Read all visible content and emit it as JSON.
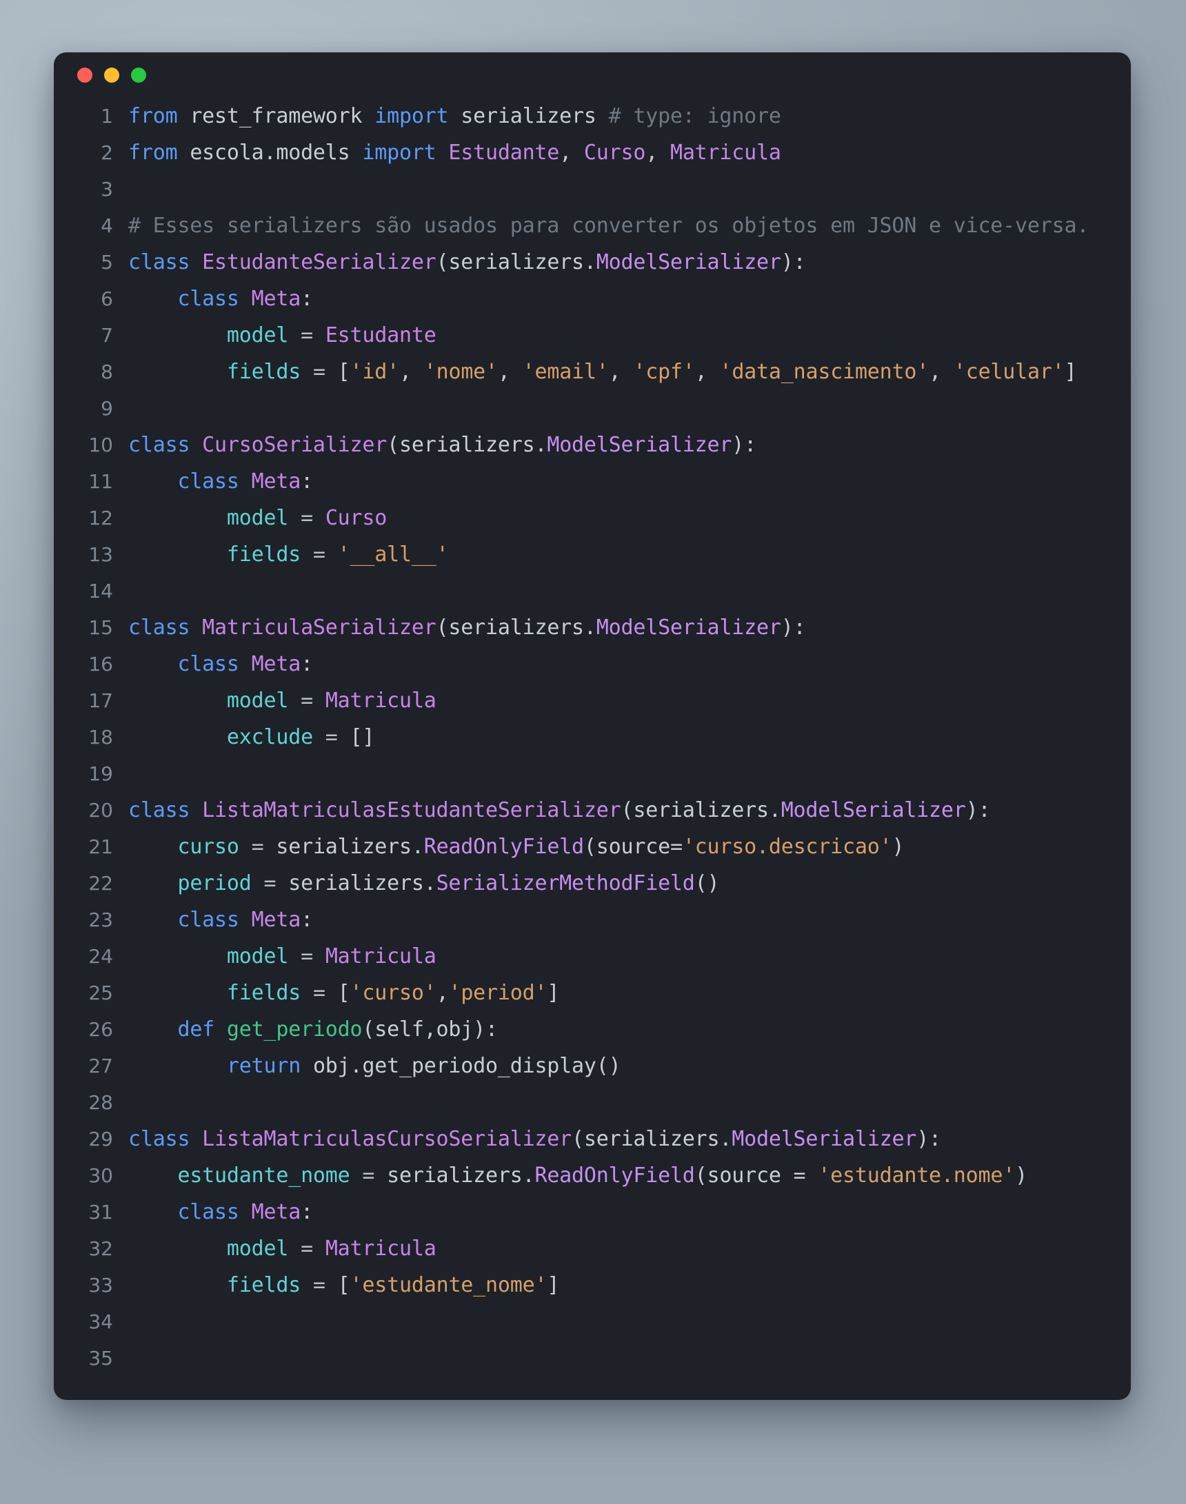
{
  "window": {
    "traffic_lights": [
      {
        "name": "close",
        "color": "#ff5f57"
      },
      {
        "name": "minimize",
        "color": "#febc2e"
      },
      {
        "name": "maximize",
        "color": "#28c840"
      }
    ],
    "background": "#1e2127",
    "page_background": "#a3afba"
  },
  "theme": {
    "keyword": "#5b9bf8",
    "class": "#c586e8",
    "attribute": "#5ed4d4",
    "string": "#d6a06a",
    "function": "#3ec98a",
    "plain": "#c9ced6",
    "comment": "#6f7884",
    "lineno": "#7e8794"
  },
  "code": {
    "language": "python",
    "total_lines": 35,
    "lines": [
      {
        "n": "1",
        "tokens": [
          {
            "t": "from ",
            "c": "kw"
          },
          {
            "t": "rest_framework ",
            "c": "plain"
          },
          {
            "t": "import ",
            "c": "kw"
          },
          {
            "t": "serializers ",
            "c": "plain"
          },
          {
            "t": "# type: ignore",
            "c": "com"
          }
        ]
      },
      {
        "n": "2",
        "tokens": [
          {
            "t": "from ",
            "c": "kw"
          },
          {
            "t": "escola.models ",
            "c": "plain"
          },
          {
            "t": "import ",
            "c": "kw"
          },
          {
            "t": "Estudante",
            "c": "cls"
          },
          {
            "t": ", ",
            "c": "plain"
          },
          {
            "t": "Curso",
            "c": "cls"
          },
          {
            "t": ", ",
            "c": "plain"
          },
          {
            "t": "Matricula",
            "c": "cls"
          }
        ]
      },
      {
        "n": "3",
        "tokens": []
      },
      {
        "n": "4",
        "tokens": [
          {
            "t": "# Esses serializers são usados para converter os objetos em JSON e vice-versa.",
            "c": "com"
          }
        ]
      },
      {
        "n": "5",
        "tokens": [
          {
            "t": "class ",
            "c": "kw"
          },
          {
            "t": "EstudanteSerializer",
            "c": "cls"
          },
          {
            "t": "(",
            "c": "plain"
          },
          {
            "t": "serializers.",
            "c": "plain"
          },
          {
            "t": "ModelSerializer",
            "c": "cls2"
          },
          {
            "t": "):",
            "c": "plain"
          }
        ]
      },
      {
        "n": "6",
        "tokens": [
          {
            "t": "    ",
            "c": "plain"
          },
          {
            "t": "class ",
            "c": "kw"
          },
          {
            "t": "Meta",
            "c": "cls"
          },
          {
            "t": ":",
            "c": "plain"
          }
        ]
      },
      {
        "n": "7",
        "tokens": [
          {
            "t": "        ",
            "c": "plain"
          },
          {
            "t": "model",
            "c": "attr"
          },
          {
            "t": " = ",
            "c": "op"
          },
          {
            "t": "Estudante",
            "c": "cls"
          }
        ]
      },
      {
        "n": "8",
        "tokens": [
          {
            "t": "        ",
            "c": "plain"
          },
          {
            "t": "fields",
            "c": "attr"
          },
          {
            "t": " = ",
            "c": "op"
          },
          {
            "t": "[",
            "c": "plain"
          },
          {
            "t": "'id'",
            "c": "str"
          },
          {
            "t": ", ",
            "c": "plain"
          },
          {
            "t": "'nome'",
            "c": "str"
          },
          {
            "t": ", ",
            "c": "plain"
          },
          {
            "t": "'email'",
            "c": "str"
          },
          {
            "t": ", ",
            "c": "plain"
          },
          {
            "t": "'cpf'",
            "c": "str"
          },
          {
            "t": ", ",
            "c": "plain"
          },
          {
            "t": "'data_nascimento'",
            "c": "str"
          },
          {
            "t": ", ",
            "c": "plain"
          },
          {
            "t": "'celular'",
            "c": "str"
          },
          {
            "t": "]",
            "c": "plain"
          }
        ]
      },
      {
        "n": "9",
        "tokens": []
      },
      {
        "n": "10",
        "tokens": [
          {
            "t": "class ",
            "c": "kw"
          },
          {
            "t": "CursoSerializer",
            "c": "cls"
          },
          {
            "t": "(",
            "c": "plain"
          },
          {
            "t": "serializers.",
            "c": "plain"
          },
          {
            "t": "ModelSerializer",
            "c": "cls2"
          },
          {
            "t": "):",
            "c": "plain"
          }
        ]
      },
      {
        "n": "11",
        "tokens": [
          {
            "t": "    ",
            "c": "plain"
          },
          {
            "t": "class ",
            "c": "kw"
          },
          {
            "t": "Meta",
            "c": "cls"
          },
          {
            "t": ":",
            "c": "plain"
          }
        ]
      },
      {
        "n": "12",
        "tokens": [
          {
            "t": "        ",
            "c": "plain"
          },
          {
            "t": "model",
            "c": "attr"
          },
          {
            "t": " = ",
            "c": "op"
          },
          {
            "t": "Curso",
            "c": "cls"
          }
        ]
      },
      {
        "n": "13",
        "tokens": [
          {
            "t": "        ",
            "c": "plain"
          },
          {
            "t": "fields",
            "c": "attr"
          },
          {
            "t": " = ",
            "c": "op"
          },
          {
            "t": "'__all__'",
            "c": "str"
          }
        ]
      },
      {
        "n": "14",
        "tokens": []
      },
      {
        "n": "15",
        "tokens": [
          {
            "t": "class ",
            "c": "kw"
          },
          {
            "t": "MatriculaSerializer",
            "c": "cls"
          },
          {
            "t": "(",
            "c": "plain"
          },
          {
            "t": "serializers.",
            "c": "plain"
          },
          {
            "t": "ModelSerializer",
            "c": "cls2"
          },
          {
            "t": "):",
            "c": "plain"
          }
        ]
      },
      {
        "n": "16",
        "tokens": [
          {
            "t": "    ",
            "c": "plain"
          },
          {
            "t": "class ",
            "c": "kw"
          },
          {
            "t": "Meta",
            "c": "cls"
          },
          {
            "t": ":",
            "c": "plain"
          }
        ]
      },
      {
        "n": "17",
        "tokens": [
          {
            "t": "        ",
            "c": "plain"
          },
          {
            "t": "model",
            "c": "attr"
          },
          {
            "t": " = ",
            "c": "op"
          },
          {
            "t": "Matricula",
            "c": "cls"
          }
        ]
      },
      {
        "n": "18",
        "tokens": [
          {
            "t": "        ",
            "c": "plain"
          },
          {
            "t": "exclude",
            "c": "attr"
          },
          {
            "t": " = ",
            "c": "op"
          },
          {
            "t": "[]",
            "c": "plain"
          }
        ]
      },
      {
        "n": "19",
        "tokens": []
      },
      {
        "n": "20",
        "tokens": [
          {
            "t": "class ",
            "c": "kw"
          },
          {
            "t": "ListaMatriculasEstudanteSerializer",
            "c": "cls"
          },
          {
            "t": "(",
            "c": "plain"
          },
          {
            "t": "serializers.",
            "c": "plain"
          },
          {
            "t": "ModelSerializer",
            "c": "cls2"
          },
          {
            "t": "):",
            "c": "plain"
          }
        ]
      },
      {
        "n": "21",
        "tokens": [
          {
            "t": "    ",
            "c": "plain"
          },
          {
            "t": "curso",
            "c": "attr"
          },
          {
            "t": " = ",
            "c": "op"
          },
          {
            "t": "serializers.",
            "c": "plain"
          },
          {
            "t": "ReadOnlyField",
            "c": "cls2"
          },
          {
            "t": "(",
            "c": "plain"
          },
          {
            "t": "source=",
            "c": "plain"
          },
          {
            "t": "'curso.descricao'",
            "c": "str"
          },
          {
            "t": ")",
            "c": "plain"
          }
        ]
      },
      {
        "n": "22",
        "tokens": [
          {
            "t": "    ",
            "c": "plain"
          },
          {
            "t": "period",
            "c": "attr"
          },
          {
            "t": " = ",
            "c": "op"
          },
          {
            "t": "serializers.",
            "c": "plain"
          },
          {
            "t": "SerializerMethodField",
            "c": "cls2"
          },
          {
            "t": "()",
            "c": "plain"
          }
        ]
      },
      {
        "n": "23",
        "tokens": [
          {
            "t": "    ",
            "c": "plain"
          },
          {
            "t": "class ",
            "c": "kw"
          },
          {
            "t": "Meta",
            "c": "cls"
          },
          {
            "t": ":",
            "c": "plain"
          }
        ]
      },
      {
        "n": "24",
        "tokens": [
          {
            "t": "        ",
            "c": "plain"
          },
          {
            "t": "model",
            "c": "attr"
          },
          {
            "t": " = ",
            "c": "op"
          },
          {
            "t": "Matricula",
            "c": "cls"
          }
        ]
      },
      {
        "n": "25",
        "tokens": [
          {
            "t": "        ",
            "c": "plain"
          },
          {
            "t": "fields",
            "c": "attr"
          },
          {
            "t": " = ",
            "c": "op"
          },
          {
            "t": "[",
            "c": "plain"
          },
          {
            "t": "'curso'",
            "c": "str"
          },
          {
            "t": ",",
            "c": "plain"
          },
          {
            "t": "'period'",
            "c": "str"
          },
          {
            "t": "]",
            "c": "plain"
          }
        ]
      },
      {
        "n": "26",
        "tokens": [
          {
            "t": "    ",
            "c": "plain"
          },
          {
            "t": "def ",
            "c": "kw"
          },
          {
            "t": "get_periodo",
            "c": "fn"
          },
          {
            "t": "(self,obj):",
            "c": "plain"
          }
        ]
      },
      {
        "n": "27",
        "tokens": [
          {
            "t": "        ",
            "c": "plain"
          },
          {
            "t": "return ",
            "c": "kw"
          },
          {
            "t": "obj.get_periodo_display()",
            "c": "plain"
          }
        ]
      },
      {
        "n": "28",
        "tokens": []
      },
      {
        "n": "29",
        "tokens": [
          {
            "t": "class ",
            "c": "kw"
          },
          {
            "t": "ListaMatriculasCursoSerializer",
            "c": "cls"
          },
          {
            "t": "(",
            "c": "plain"
          },
          {
            "t": "serializers.",
            "c": "plain"
          },
          {
            "t": "ModelSerializer",
            "c": "cls2"
          },
          {
            "t": "):",
            "c": "plain"
          }
        ]
      },
      {
        "n": "30",
        "tokens": [
          {
            "t": "    ",
            "c": "plain"
          },
          {
            "t": "estudante_nome",
            "c": "attr"
          },
          {
            "t": " = ",
            "c": "op"
          },
          {
            "t": "serializers.",
            "c": "plain"
          },
          {
            "t": "ReadOnlyField",
            "c": "cls2"
          },
          {
            "t": "(",
            "c": "plain"
          },
          {
            "t": "source = ",
            "c": "plain"
          },
          {
            "t": "'estudante.nome'",
            "c": "str"
          },
          {
            "t": ")",
            "c": "plain"
          }
        ]
      },
      {
        "n": "31",
        "tokens": [
          {
            "t": "    ",
            "c": "plain"
          },
          {
            "t": "class ",
            "c": "kw"
          },
          {
            "t": "Meta",
            "c": "cls"
          },
          {
            "t": ":",
            "c": "plain"
          }
        ]
      },
      {
        "n": "32",
        "tokens": [
          {
            "t": "        ",
            "c": "plain"
          },
          {
            "t": "model",
            "c": "attr"
          },
          {
            "t": " = ",
            "c": "op"
          },
          {
            "t": "Matricula",
            "c": "cls"
          }
        ]
      },
      {
        "n": "33",
        "tokens": [
          {
            "t": "        ",
            "c": "plain"
          },
          {
            "t": "fields",
            "c": "attr"
          },
          {
            "t": " = ",
            "c": "op"
          },
          {
            "t": "[",
            "c": "plain"
          },
          {
            "t": "'estudante_nome'",
            "c": "str"
          },
          {
            "t": "]",
            "c": "plain"
          }
        ]
      },
      {
        "n": "34",
        "tokens": []
      },
      {
        "n": "35",
        "tokens": []
      }
    ]
  }
}
